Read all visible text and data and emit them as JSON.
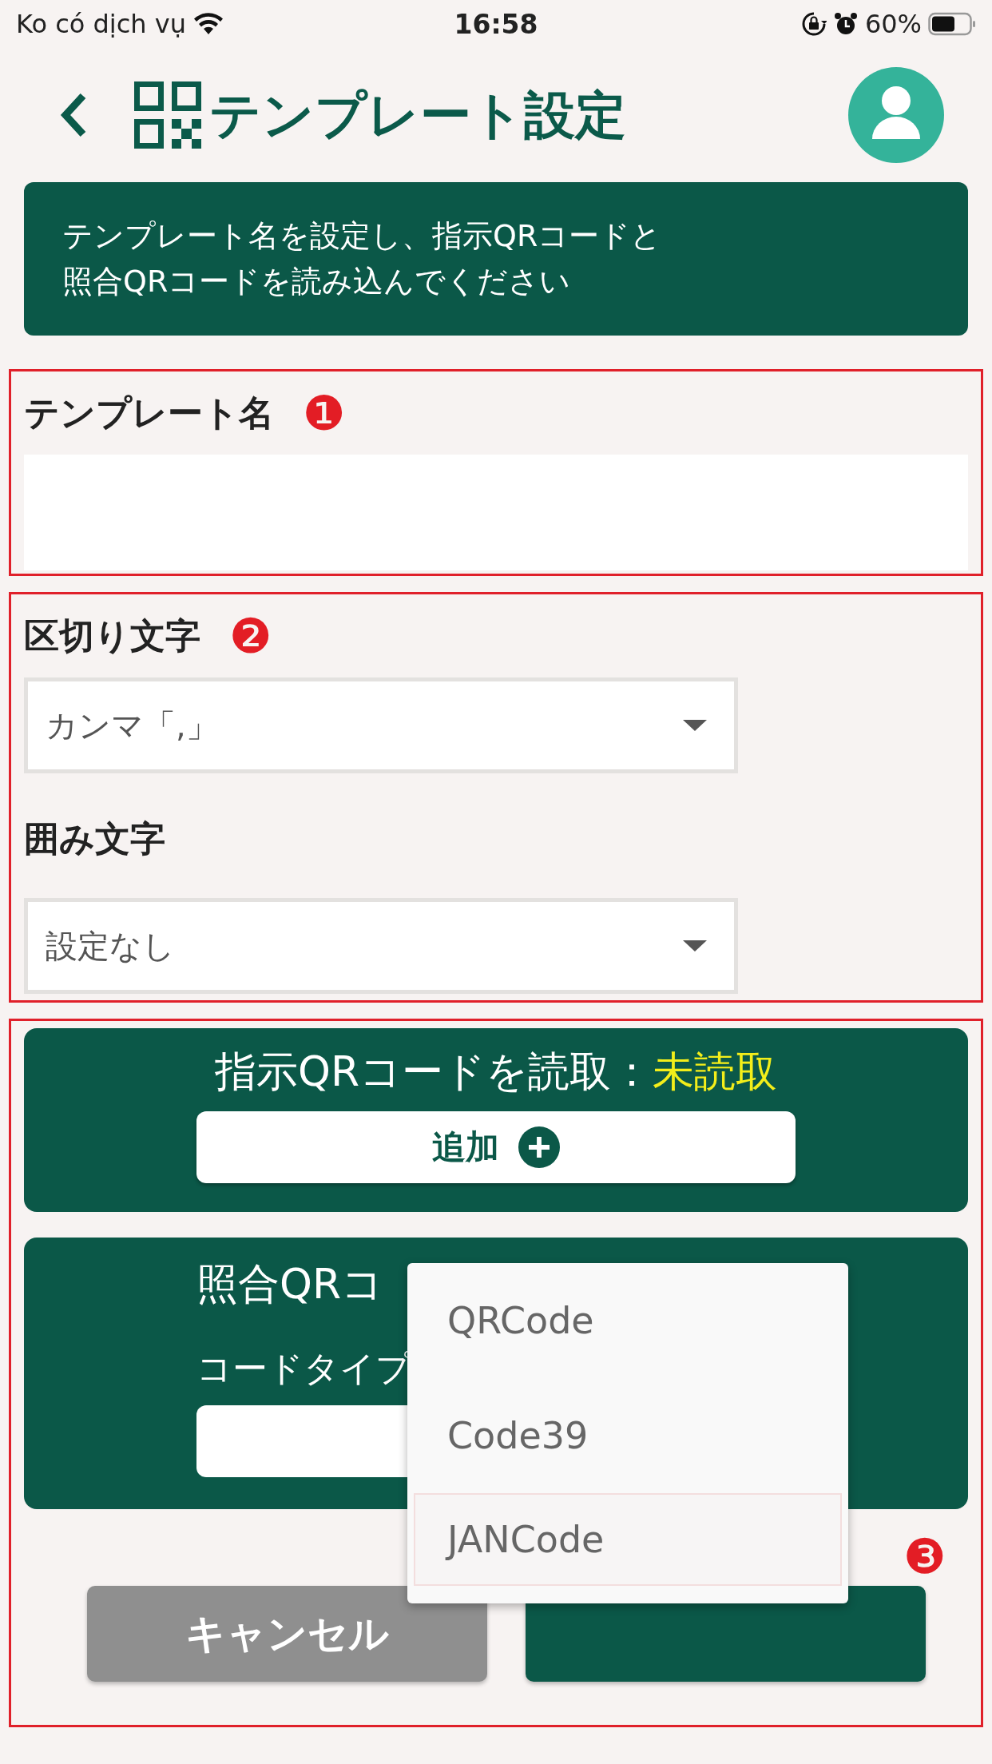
{
  "status_bar": {
    "carrier": "Ko có dịch vụ",
    "time": "16:58",
    "battery": "60%"
  },
  "header": {
    "title": "テンプレート設定"
  },
  "banner": {
    "lines": [
      "テンプレート名を設定し、指示QRコードと",
      "照合QRコードを読み込んでください"
    ]
  },
  "sections": [
    {
      "badge": "❶",
      "fields": [
        {
          "kind": "text",
          "label": "テンプレート名"
        }
      ]
    },
    {
      "badge": "❷",
      "fields": [
        {
          "kind": "select",
          "label": "区切り文字",
          "value": "カンマ「,」"
        },
        {
          "kind": "select",
          "label": "囲み文字",
          "value": "設定なし"
        }
      ]
    }
  ],
  "scan_section": {
    "badge": "❸",
    "instruction_card": {
      "title": "指示QRコードを読取：",
      "status": "未読取",
      "button": "追加"
    },
    "reference_card": {
      "title": "照合QRコ",
      "code_type_label": "コードタイプ"
    },
    "dropdown": [
      {
        "label": "QRCode",
        "selected": false
      },
      {
        "label": "Code39",
        "selected": false
      },
      {
        "label": "JANCode",
        "selected": true
      }
    ],
    "buttons": [
      {
        "kind": "secondary",
        "label": "キャンセル"
      },
      {
        "kind": "primary"
      }
    ]
  }
}
